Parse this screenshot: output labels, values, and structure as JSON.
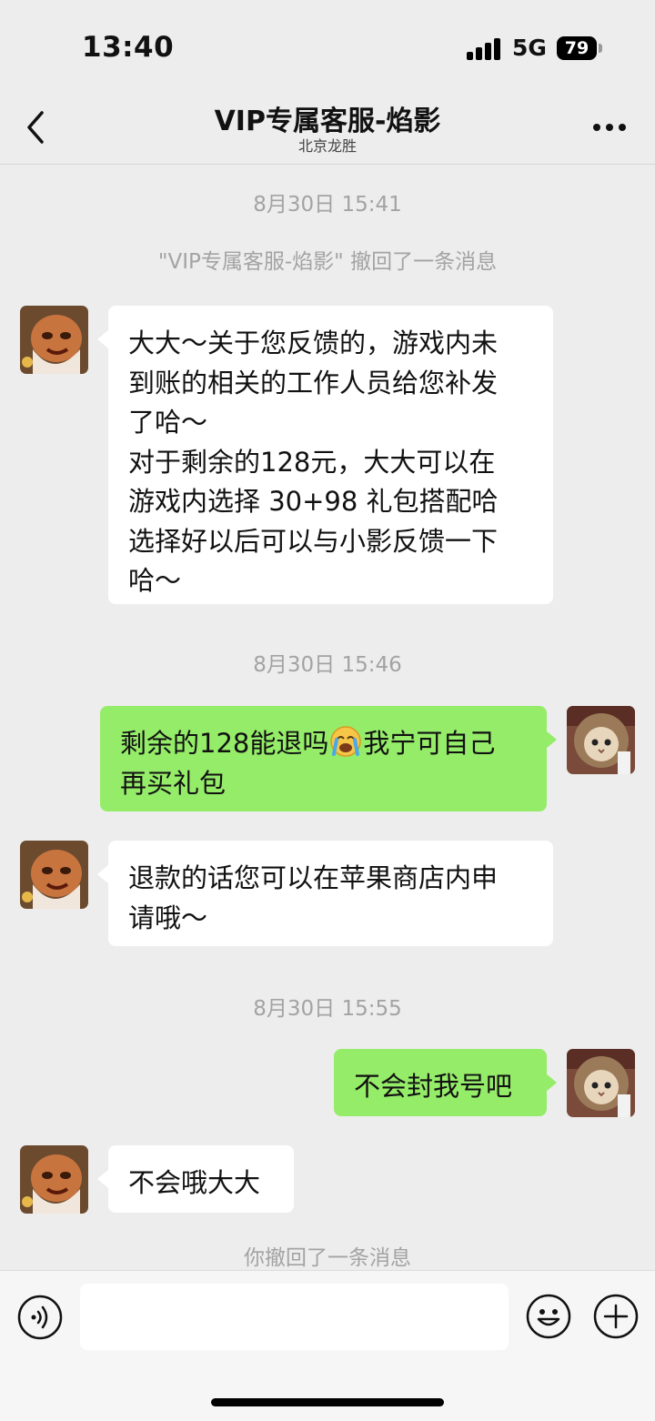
{
  "status_bar": {
    "time": "13:40",
    "network": "5G",
    "battery": "79"
  },
  "header": {
    "title": "VIP专属客服-焰影",
    "subtitle": "北京龙胜",
    "back_icon": "chevron-left-icon",
    "more_icon": "more-dots-icon"
  },
  "messages": [
    {
      "kind": "time",
      "text": "8月30日 15:41"
    },
    {
      "kind": "system",
      "text": "\"VIP专属客服-焰影\" 撤回了一条消息"
    },
    {
      "kind": "incoming",
      "avatar": "agent-avatar-dwarf",
      "text": "大大～关于您反馈的，游戏内未\n到账的相关的工作人员给您补发\n了哈～\n对于剩余的128元，大大可以在\n游戏内选择 30+98 礼包搭配哈\n选择好以后可以与小影反馈一下\n哈～"
    },
    {
      "kind": "time",
      "text": "8月30日 15:46"
    },
    {
      "kind": "outgoing",
      "avatar": "user-avatar-cat",
      "text": "剩余的128能退吗",
      "emoji": "loudly-crying-face",
      "text2": "我宁可自己\n再买礼包"
    },
    {
      "kind": "incoming",
      "avatar": "agent-avatar-dwarf",
      "text": "退款的话您可以在苹果商店内申\n请哦～"
    },
    {
      "kind": "time",
      "text": "8月30日 15:55"
    },
    {
      "kind": "outgoing",
      "avatar": "user-avatar-cat",
      "text": "不会封我号吧"
    },
    {
      "kind": "incoming",
      "avatar": "agent-avatar-dwarf",
      "text": "不会哦大大"
    },
    {
      "kind": "system",
      "text": "你撤回了一条消息"
    }
  ],
  "input_bar": {
    "placeholder": "",
    "voice_icon": "voice-icon",
    "emoji_icon": "emoji-icon",
    "plus_icon": "plus-icon"
  },
  "colors": {
    "background": "#ededed",
    "outgoing_bubble": "#95ec69",
    "incoming_bubble": "#ffffff",
    "system_text": "#a3a3a3"
  }
}
